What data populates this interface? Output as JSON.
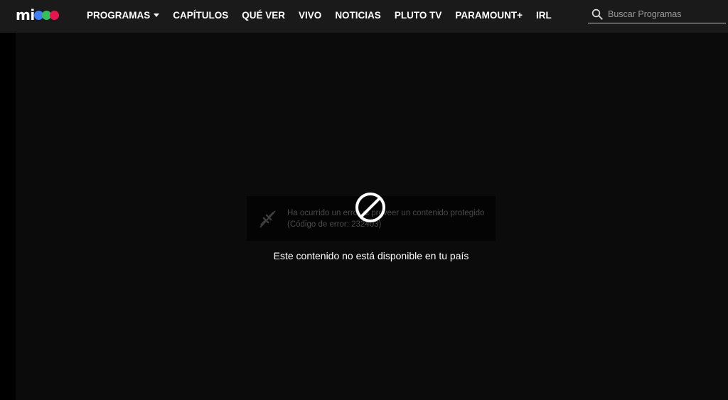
{
  "logo": {
    "text": "mi",
    "dots": [
      "#3f7ef6",
      "#33c05a",
      "#e8144f"
    ]
  },
  "nav": {
    "items": [
      {
        "label": "PROGRAMAS",
        "dropdown": true
      },
      {
        "label": "CAPÍTULOS"
      },
      {
        "label": "QUÉ VER"
      },
      {
        "label": "VIVO"
      },
      {
        "label": "NOTICIAS"
      },
      {
        "label": "PLUTO TV"
      },
      {
        "label": "PARAMOUNT+"
      },
      {
        "label": "IRL"
      }
    ]
  },
  "search": {
    "placeholder": "Buscar Programas",
    "icon": "search-icon"
  },
  "player": {
    "drm_error_line1": "Ha ocurrido un error al proveer un contenido protegido",
    "drm_error_line2": "(Código de error: 232403)",
    "drm_icon": "broken-connection-icon",
    "block_icon": "prohibited-icon",
    "message": "Este contenido no está disponible en tu país"
  },
  "colors": {
    "nav_bg": "#1a1a1a",
    "player_bg": "#0b0b0b",
    "page_bg": "#000000"
  }
}
